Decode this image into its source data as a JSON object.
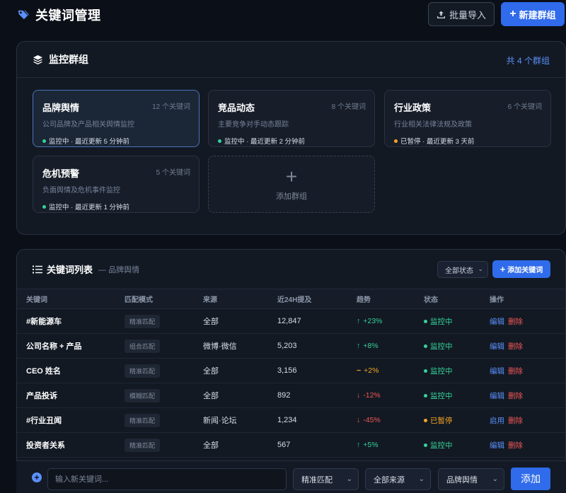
{
  "header": {
    "title": "关键词管理",
    "import_label": "批量导入",
    "new_group_label": "新建群组"
  },
  "groups_panel": {
    "title": "监控群组",
    "total_prefix": "共",
    "total_count": "4",
    "total_suffix": "个群组",
    "cards": [
      {
        "name": "品牌舆情",
        "count": "12 个关键词",
        "desc": "公司品牌及产品相关舆情监控",
        "status": "监控中 · 最近更新 5 分钟前",
        "state": "green",
        "active": true
      },
      {
        "name": "竞品动态",
        "count": "8 个关键词",
        "desc": "主要竞争对手动态跟踪",
        "status": "监控中 · 最近更新 2 分钟前",
        "state": "green",
        "active": false
      },
      {
        "name": "行业政策",
        "count": "6 个关键词",
        "desc": "行业相关法律法规及政策",
        "status": "已暂停 · 最近更新 3 天前",
        "state": "orange",
        "active": false
      },
      {
        "name": "危机预警",
        "count": "5 个关键词",
        "desc": "负面舆情及危机事件监控",
        "status": "监控中 · 最近更新 1 分钟前",
        "state": "green",
        "active": false
      }
    ],
    "add_label": "添加群组"
  },
  "keyword_panel": {
    "title": "关键词列表",
    "subtitle": "— 品牌舆情",
    "status_filter": "全部状态",
    "add_keyword_label": "添加关键词",
    "columns": [
      "关键词",
      "匹配模式",
      "来源",
      "近24H提及",
      "趋势",
      "状态",
      "操作"
    ],
    "rows": [
      {
        "keyword": "#新能源车",
        "mode": "精准匹配",
        "source": "全部",
        "mentions": "12,847",
        "trend": "+23%",
        "trend_dir": "up",
        "status": "监控中",
        "state": "green",
        "action1": "编辑",
        "action2": "删除"
      },
      {
        "keyword": "公司名称 + 产品",
        "mode": "组合匹配",
        "source": "微博·微信",
        "mentions": "5,203",
        "trend": "+8%",
        "trend_dir": "up",
        "status": "监控中",
        "state": "green",
        "action1": "编辑",
        "action2": "删除"
      },
      {
        "keyword": "CEO 姓名",
        "mode": "精准匹配",
        "source": "全部",
        "mentions": "3,156",
        "trend": "+2%",
        "trend_dir": "flat",
        "status": "监控中",
        "state": "green",
        "action1": "编辑",
        "action2": "删除"
      },
      {
        "keyword": "产品投诉",
        "mode": "模糊匹配",
        "source": "全部",
        "mentions": "892",
        "trend": "-12%",
        "trend_dir": "down",
        "status": "监控中",
        "state": "green",
        "action1": "编辑",
        "action2": "删除"
      },
      {
        "keyword": "#行业丑闻",
        "mode": "精准匹配",
        "source": "新闻·论坛",
        "mentions": "1,234",
        "trend": "-45%",
        "trend_dir": "down",
        "status": "已暂停",
        "state": "orange",
        "action1": "启用",
        "action2": "删除"
      },
      {
        "keyword": "投资者关系",
        "mode": "精准匹配",
        "source": "全部",
        "mentions": "567",
        "trend": "+5%",
        "trend_dir": "up",
        "status": "监控中",
        "state": "green",
        "action1": "编辑",
        "action2": "删除"
      }
    ]
  },
  "bottom_bar": {
    "input_placeholder": "输入新关键词...",
    "mode_select": "精准匹配",
    "source_select": "全部来源",
    "group_select": "品牌舆情",
    "submit_label": "添加"
  },
  "colors": {
    "accent": "#2f6bea",
    "link": "#5b8ff9",
    "ok": "#34d399",
    "warn": "#f5a524",
    "danger": "#f25757"
  }
}
